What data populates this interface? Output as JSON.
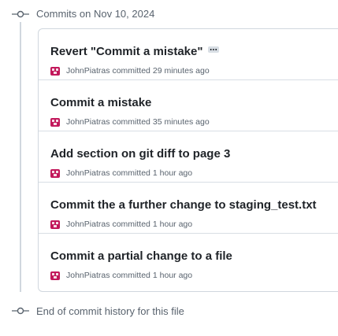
{
  "history": {
    "group_header": "Commits on Nov 10, 2024",
    "end_label": "End of commit history for this file",
    "commits": [
      {
        "title": "Revert \"Commit a mistake\"",
        "author": "JohnPiatras",
        "action": "committed",
        "time": "29 minutes ago",
        "has_ellipsis": true
      },
      {
        "title": "Commit a mistake",
        "author": "JohnPiatras",
        "action": "committed",
        "time": "35 minutes ago"
      },
      {
        "title": "Add section on git diff to page 3",
        "author": "JohnPiatras",
        "action": "committed",
        "time": "1 hour ago"
      },
      {
        "title": "Commit the a further change to staging_test.txt",
        "author": "JohnPiatras",
        "action": "committed",
        "time": "1 hour ago"
      },
      {
        "title": "Commit a partial change to a file",
        "author": "JohnPiatras",
        "action": "committed",
        "time": "1 hour ago"
      }
    ]
  },
  "colors": {
    "timeline": "#d0d7de",
    "avatar": "#c2185b",
    "muted_text": "#59636e"
  },
  "icons": {
    "commit_node": "git-commit-icon",
    "avatar": "identicon-avatar",
    "expand": "ellipsis-icon"
  }
}
